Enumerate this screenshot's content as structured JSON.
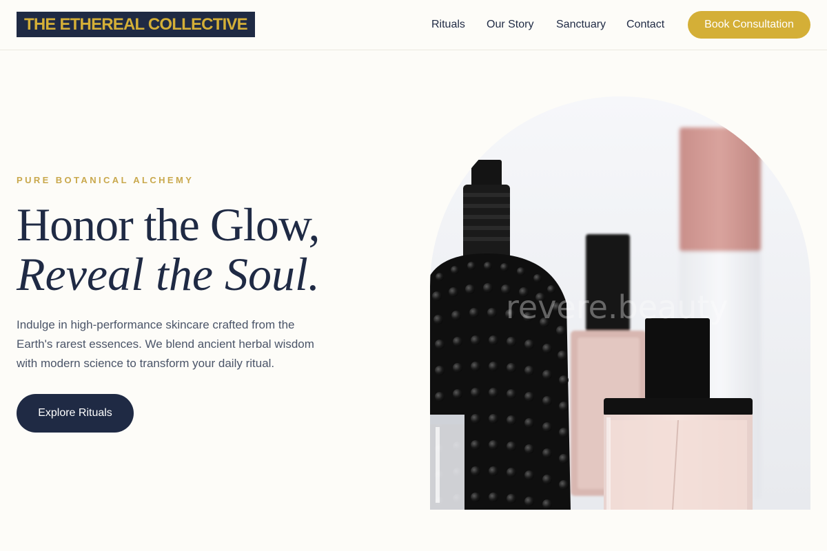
{
  "header": {
    "logo_text": "THE ETHEREAL COLLECTIVE",
    "nav": {
      "rituals": "Rituals",
      "our_story": "Our Story",
      "sanctuary": "Sanctuary",
      "contact": "Contact"
    },
    "cta_label": "Book Consultation"
  },
  "hero": {
    "eyebrow": "PURE BOTANICAL ALCHEMY",
    "headline_line1": "Honor the Glow,",
    "headline_line2": "Reveal the Soul.",
    "description": "Indulge in high-performance skincare crafted from the Earth's rarest essences. We blend ancient herbal wisdom with modern science to transform your daily ritual.",
    "cta_label": "Explore Rituals",
    "image": {
      "subject": "perfume-and-skincare-bottles",
      "watermark": "revere.beauty"
    }
  },
  "colors": {
    "background": "#fdfcf8",
    "navy": "#1f2a44",
    "gold": "#d4af37",
    "eyebrow_gold": "#c9a84c",
    "body_text": "#4a5468"
  }
}
